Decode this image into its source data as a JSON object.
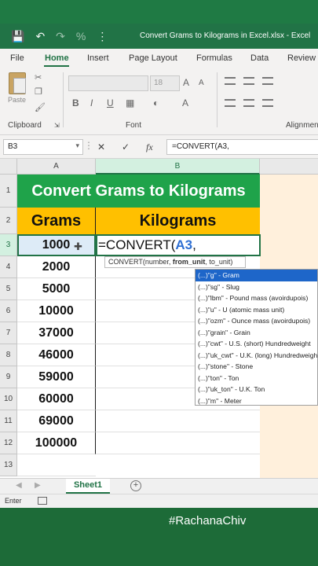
{
  "title_bar": {
    "document_title": "Convert Grams to Kilograms in Excel.xlsx  -  Excel",
    "icons": [
      "save-icon",
      "undo-icon",
      "redo-icon",
      "percent-icon",
      "customize-qat-icon"
    ]
  },
  "ribbon_tabs": [
    "File",
    "Home",
    "Insert",
    "Page Layout",
    "Formulas",
    "Data",
    "Review"
  ],
  "active_tab": "Home",
  "ribbon": {
    "paste_label": "Paste",
    "clipboard_label": "Clipboard",
    "font_label": "Font",
    "alignment_label": "Alignmen",
    "font_size": "18",
    "bold": "B",
    "italic": "I",
    "underline": "U"
  },
  "formula_bar": {
    "name_box": "B3",
    "cancel": "✕",
    "enter": "✓",
    "fx": "fx",
    "formula": "=CONVERT(A3,"
  },
  "columns": [
    "A",
    "B"
  ],
  "rows": [
    "1",
    "2",
    "3",
    "4",
    "5",
    "6",
    "7",
    "8",
    "9",
    "10",
    "11",
    "12",
    "13"
  ],
  "sheet": {
    "title": "Convert Grams to Kilograms",
    "header_grams": "Grams",
    "header_kilograms": "Kilograms",
    "grams": [
      "1000",
      "2000",
      "5000",
      "10000",
      "37000",
      "46000",
      "59000",
      "60000",
      "69000",
      "100000"
    ],
    "edit_prefix": "=CONVERT(",
    "edit_ref": "A3",
    "edit_suffix": ","
  },
  "tooltip": {
    "func": "CONVERT(number, ",
    "bold_arg": "from_unit",
    "rest": ", to_unit)"
  },
  "autocomplete": [
    "(...)\"g\" - Gram",
    "(...)\"sg\" - Slug",
    "(...)\"lbm\" - Pound mass (avoirdupois)",
    "(...)\"u\" - U (atomic mass unit)",
    "(...)\"ozm\" - Ounce mass (avoirdupois)",
    "(...)\"grain\" - Grain",
    "(...)\"cwt\" - U.S. (short) Hundredweight",
    "(...)\"uk_cwt\" - U.K. (long) Hundredweight",
    "(...)\"stone\" - Stone",
    "(...)\"ton\" - Ton",
    "(...)\"uk_ton\" - U.K. Ton",
    "(...)\"m\" - Meter"
  ],
  "sheet_tab": "Sheet1",
  "status": {
    "mode": "Enter"
  },
  "watermark": "#RachanaChiv",
  "colors": {
    "excel_green": "#217346",
    "title_fill": "#1fa34a",
    "header_fill": "#ffc000",
    "selection_blue": "#1e66c9"
  }
}
